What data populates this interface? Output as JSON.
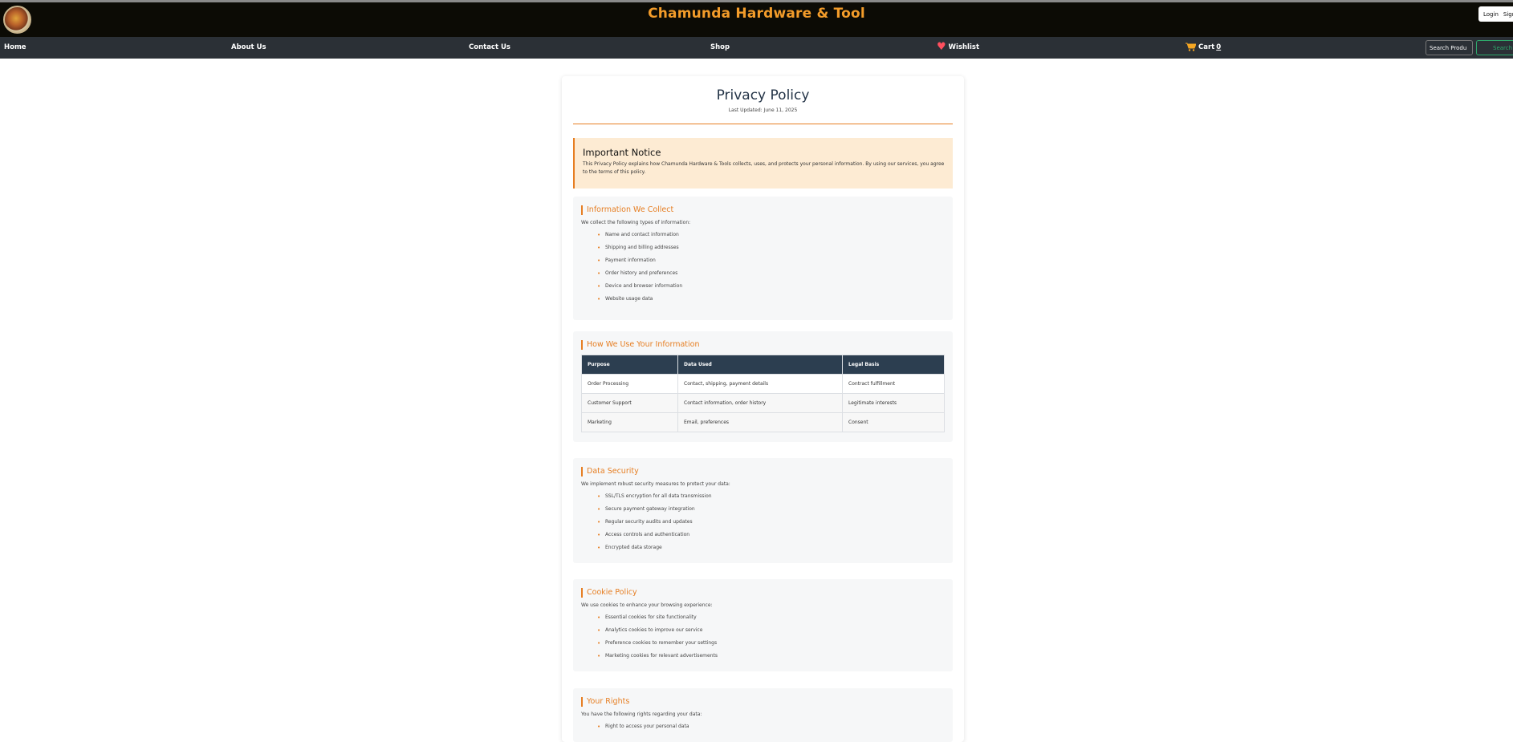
{
  "header": {
    "site_title": "Chamunda Hardware & Tool",
    "login": "Login",
    "signup": "Sign"
  },
  "nav": {
    "home": "Home",
    "about": "About Us",
    "contact": "Contact Us",
    "shop": "Shop",
    "wishlist": "Wishlist",
    "cart": "Cart",
    "cart_count": "0",
    "search_placeholder": "Search Produ",
    "search_button": "Search"
  },
  "page": {
    "title": "Privacy Policy",
    "updated": "Last Updated: June 11, 2025"
  },
  "notice": {
    "title": "Important Notice",
    "text": "This Privacy Policy explains how Chamunda Hardware & Tools collects, uses, and protects your personal information. By using our services, you agree to the terms of this policy."
  },
  "collect": {
    "title": "Information We Collect",
    "intro": "We collect the following types of information:",
    "items": [
      "Name and contact information",
      "Shipping and billing addresses",
      "Payment information",
      "Order history and preferences",
      "Device and browser information",
      "Website usage data"
    ]
  },
  "use": {
    "title": "How We Use Your Information",
    "headers": [
      "Purpose",
      "Data Used",
      "Legal Basis"
    ],
    "rows": [
      [
        "Order Processing",
        "Contact, shipping, payment details",
        "Contract fulfillment"
      ],
      [
        "Customer Support",
        "Contact information, order history",
        "Legitimate interests"
      ],
      [
        "Marketing",
        "Email, preferences",
        "Consent"
      ]
    ]
  },
  "security": {
    "title": "Data Security",
    "intro": "We implement robust security measures to protect your data:",
    "items": [
      "SSL/TLS encryption for all data transmission",
      "Secure payment gateway integration",
      "Regular security audits and updates",
      "Access controls and authentication",
      "Encrypted data storage"
    ]
  },
  "cookies": {
    "title": "Cookie Policy",
    "intro": "We use cookies to enhance your browsing experience:",
    "items": [
      "Essential cookies for site functionality",
      "Analytics cookies to improve our service",
      "Preference cookies to remember your settings",
      "Marketing cookies for relevant advertisements"
    ]
  },
  "rights": {
    "title": "Your Rights",
    "intro": "You have the following rights regarding your data:",
    "items": [
      "Right to access your personal data"
    ]
  },
  "colors": {
    "accent": "#e67e22",
    "header_bg": "#0c0b05",
    "nav_bg": "#2b3036",
    "table_header": "#2c3e50"
  }
}
